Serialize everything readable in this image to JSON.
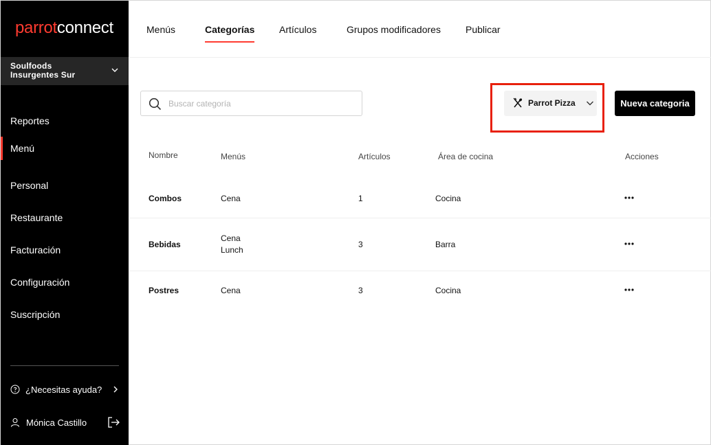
{
  "brand": {
    "logo_part1": "parrot",
    "logo_part2": "connect",
    "accent": "#ff3b30"
  },
  "store": {
    "name": "Soulfoods\nInsurgentes Sur",
    "icon": "chevron-down-icon"
  },
  "sidebar": {
    "items": [
      {
        "label": "Reportes"
      },
      {
        "label": "Menú",
        "active": true
      },
      {
        "label": "Personal"
      },
      {
        "label": "Restaurante"
      },
      {
        "label": "Facturación"
      },
      {
        "label": "Configuración"
      },
      {
        "label": "Suscripción"
      }
    ],
    "help_label": "¿Necesitas ayuda?",
    "user_name": "Mónica Castillo"
  },
  "tabs": [
    {
      "label": "Menús"
    },
    {
      "label": "Categorías",
      "active": true
    },
    {
      "label": "Artículos"
    },
    {
      "label": "Grupos modificadores"
    },
    {
      "label": "Publicar"
    }
  ],
  "search": {
    "placeholder": "Buscar categoría",
    "value": ""
  },
  "menu_selector": {
    "value": "Parrot Pizza",
    "icon": "utensils-icon"
  },
  "new_category_label": "Nueva categoria",
  "table": {
    "headers": [
      "Nombre",
      "Menús",
      "Artículos",
      "Área de cocina",
      "Acciones"
    ],
    "rows": [
      {
        "name": "Combos",
        "menus": [
          "Cena"
        ],
        "articles": "1",
        "kitchen": "Cocina"
      },
      {
        "name": "Bebidas",
        "menus": [
          "Cena",
          "Lunch"
        ],
        "articles": "3",
        "kitchen": "Barra"
      },
      {
        "name": "Postres",
        "menus": [
          "Cena"
        ],
        "articles": "3",
        "kitchen": "Cocina"
      }
    ]
  }
}
